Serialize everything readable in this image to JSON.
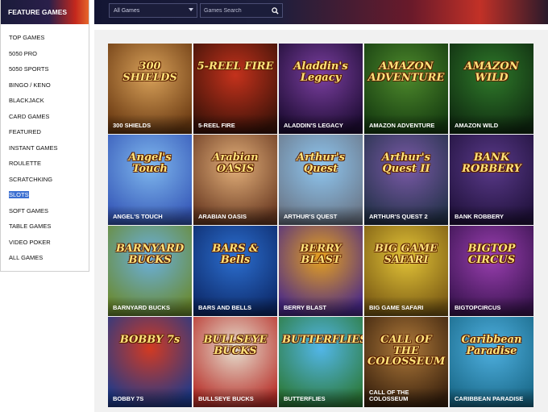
{
  "sidebar": {
    "header": "FEATURE GAMES",
    "items": [
      {
        "label": "TOP GAMES"
      },
      {
        "label": "5050 PRO"
      },
      {
        "label": "5050 SPORTS"
      },
      {
        "label": "BINGO / KENO"
      },
      {
        "label": "BLACKJACK"
      },
      {
        "label": "CARD GAMES"
      },
      {
        "label": "FEATURED"
      },
      {
        "label": "INSTANT GAMES"
      },
      {
        "label": "ROULETTE"
      },
      {
        "label": "SCRATCHKING"
      },
      {
        "label": "SLOTS",
        "selected": true
      },
      {
        "label": "SOFT GAMES"
      },
      {
        "label": "TABLE GAMES"
      },
      {
        "label": "VIDEO POKER"
      },
      {
        "label": "ALL GAMES"
      }
    ]
  },
  "topbar": {
    "filter_value": "All Games",
    "search_placeholder": "Games Search"
  },
  "games": [
    {
      "name": "300 SHIELDS",
      "logo": "300 SHIELDS",
      "colors": [
        "#d9a25a",
        "#6b3a12"
      ]
    },
    {
      "name": "5-REEL FIRE",
      "logo": "5-REEL FIRE",
      "colors": [
        "#c4321c",
        "#3a1208"
      ]
    },
    {
      "name": "ALADDIN'S LEGACY",
      "logo": "Aladdin's Legacy",
      "colors": [
        "#7b3fa0",
        "#1d0c33"
      ]
    },
    {
      "name": "AMAZON ADVENTURE",
      "logo": "AMAZON ADVENTURE",
      "colors": [
        "#4e8a2c",
        "#153b10"
      ]
    },
    {
      "name": "AMAZON WILD",
      "logo": "AMAZON WILD",
      "colors": [
        "#2f7a2a",
        "#0f2a10"
      ]
    },
    {
      "name": "ANGEL'S TOUCH",
      "logo": "Angel's Touch",
      "colors": [
        "#7fb8ee",
        "#3658b8"
      ]
    },
    {
      "name": "ARABIAN OASIS",
      "logo": "Arabian OASIS",
      "colors": [
        "#e3b07a",
        "#6a3a22"
      ]
    },
    {
      "name": "ARTHUR'S QUEST",
      "logo": "Arthur's Quest",
      "colors": [
        "#8ec6f0",
        "#6b7788"
      ]
    },
    {
      "name": "ARTHUR'S QUEST 2",
      "logo": "Arthur's Quest II",
      "colors": [
        "#7b5aa8",
        "#24324a"
      ]
    },
    {
      "name": "BANK ROBBERY",
      "logo": "BANK ROBBERY",
      "colors": [
        "#5a3a8a",
        "#21123d"
      ]
    },
    {
      "name": "BARNYARD BUCKS",
      "logo": "BARNYARD BUCKS",
      "colors": [
        "#6ab0e0",
        "#6a8a30"
      ]
    },
    {
      "name": "BARS AND BELLS",
      "logo": "BARS & Bells",
      "colors": [
        "#2c6fd0",
        "#0d2a6a"
      ]
    },
    {
      "name": "BERRY BLAST",
      "logo": "BERRY BLAST",
      "colors": [
        "#e6a21f",
        "#4a2a88"
      ]
    },
    {
      "name": "BIG GAME SAFARI",
      "logo": "BIG GAME SAFARI",
      "colors": [
        "#e3c437",
        "#7a5a14"
      ]
    },
    {
      "name": "BIGTOPCIRCUS",
      "logo": "BIGTOP CIRCUS",
      "colors": [
        "#9a3fb0",
        "#3a1450"
      ]
    },
    {
      "name": "BOBBY 7S",
      "logo": "BOBBY 7s",
      "colors": [
        "#d23a22",
        "#1f3a8a"
      ]
    },
    {
      "name": "BULLSEYE BUCKS",
      "logo": "BULLSEYE BUCKS",
      "colors": [
        "#e6e0d0",
        "#b8302a"
      ]
    },
    {
      "name": "BUTTERFLIES",
      "logo": "BUTTERFLIES",
      "colors": [
        "#52b6e8",
        "#2d7a3a"
      ]
    },
    {
      "name": "CALL OF THE COLOSSEUM",
      "logo": "CALL OF THE COLOSSEUM",
      "colors": [
        "#b07a3a",
        "#3a220e"
      ]
    },
    {
      "name": "CARIBBEAN PARADISE",
      "logo": "Caribbean Paradise",
      "colors": [
        "#4fb0e0",
        "#1a6a8a"
      ]
    }
  ]
}
